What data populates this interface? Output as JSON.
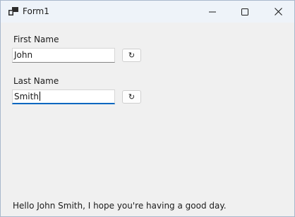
{
  "window": {
    "title": "Form1",
    "icon": "windows-forms-app-icon",
    "controls": {
      "minimize_icon": "minimize-icon",
      "maximize_icon": "maximize-icon",
      "close_icon": "close-icon"
    }
  },
  "form": {
    "first_name": {
      "label": "First Name",
      "value": "John",
      "reset_symbol": "↻"
    },
    "last_name": {
      "label": "Last Name",
      "value": "Smith",
      "reset_symbol": "↻"
    }
  },
  "greeting": "Hello John Smith, I hope you're having a good day.",
  "colors": {
    "title_bar": "#eef3f9",
    "client_area": "#f0f0f0",
    "focus_accent": "#0067c0"
  }
}
